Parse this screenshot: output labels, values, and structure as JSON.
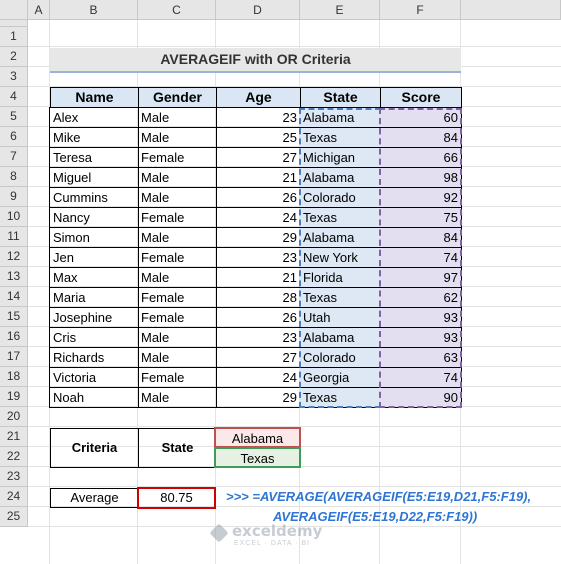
{
  "columns": [
    "A",
    "B",
    "C",
    "D",
    "E",
    "F"
  ],
  "rows": [
    "1",
    "2",
    "3",
    "4",
    "5",
    "6",
    "7",
    "8",
    "9",
    "10",
    "11",
    "12",
    "13",
    "14",
    "15",
    "16",
    "17",
    "18",
    "19",
    "20",
    "21",
    "22",
    "23",
    "24",
    "25"
  ],
  "title": "AVERAGEIF with OR Criteria",
  "headers": [
    "Name",
    "Gender",
    "Age",
    "State",
    "Score"
  ],
  "data": [
    [
      "Alex",
      "Male",
      "23",
      "Alabama",
      "60"
    ],
    [
      "Mike",
      "Male",
      "25",
      "Texas",
      "84"
    ],
    [
      "Teresa",
      "Female",
      "27",
      "Michigan",
      "66"
    ],
    [
      "Miguel",
      "Male",
      "21",
      "Alabama",
      "98"
    ],
    [
      "Cummins",
      "Male",
      "26",
      "Colorado",
      "92"
    ],
    [
      "Nancy",
      "Female",
      "24",
      "Texas",
      "75"
    ],
    [
      "Simon",
      "Male",
      "29",
      "Alabama",
      "84"
    ],
    [
      "Jen",
      "Female",
      "23",
      "New York",
      "74"
    ],
    [
      "Max",
      "Male",
      "21",
      "Florida",
      "97"
    ],
    [
      "Maria",
      "Female",
      "28",
      "Texas",
      "62"
    ],
    [
      "Josephine",
      "Female",
      "26",
      "Utah",
      "93"
    ],
    [
      "Cris",
      "Male",
      "23",
      "Alabama",
      "93"
    ],
    [
      "Richards",
      "Male",
      "27",
      "Colorado",
      "63"
    ],
    [
      "Victoria",
      "Female",
      "24",
      "Georgia",
      "74"
    ],
    [
      "Noah",
      "Male",
      "29",
      "Texas",
      "90"
    ]
  ],
  "criteria": {
    "label": "Criteria",
    "field": "State",
    "value1": "Alabama",
    "value2": "Texas"
  },
  "average": {
    "label": "Average",
    "value": "80.75"
  },
  "formula": {
    "line1": ">>> =AVERAGE(AVERAGEIF(E5:E19,D21,F5:F19),",
    "line2": "AVERAGEIF(E5:E19,D22,F5:F19))"
  },
  "watermark": {
    "name": "exceldemy",
    "tagline": "EXCEL · DATA · BI"
  },
  "colors": {
    "header_fill": "#dae6f4",
    "state_fill": "#dde8f4",
    "score_fill": "#e4dff0",
    "alabama_border": "#c0504d",
    "texas_border": "#3f9b5a",
    "average_border": "#d00000",
    "formula_text": "#2e75d4"
  }
}
